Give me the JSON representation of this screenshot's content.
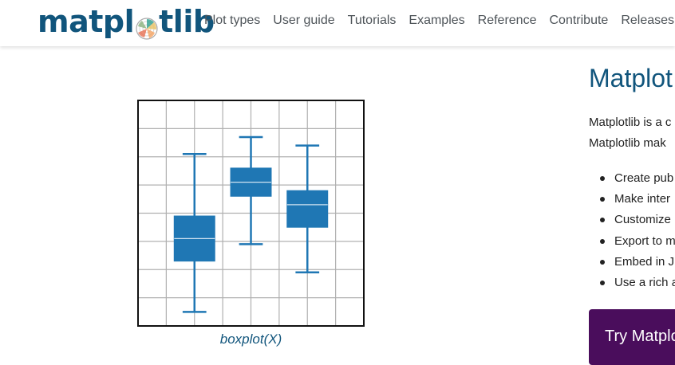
{
  "header": {
    "logo_text_left": "matpl",
    "logo_text_right": "tlib",
    "nav": [
      "Plot types",
      "User guide",
      "Tutorials",
      "Examples",
      "Reference",
      "Contribute",
      "Releases"
    ]
  },
  "figure": {
    "caption": "boxplot(X)"
  },
  "chart_data": {
    "type": "boxplot",
    "title": "",
    "xlabel": "",
    "ylabel": "",
    "xlim": [
      0,
      8
    ],
    "ylim": [
      0,
      8
    ],
    "grid": true,
    "color": "#1f77b4",
    "boxes": [
      {
        "x": 2,
        "whisker_low": 0.5,
        "q1": 2.3,
        "median": 3.1,
        "q3": 3.9,
        "whisker_high": 6.1
      },
      {
        "x": 4,
        "whisker_low": 2.9,
        "q1": 4.6,
        "median": 5.1,
        "q3": 5.6,
        "whisker_high": 6.7
      },
      {
        "x": 6,
        "whisker_low": 1.9,
        "q1": 3.5,
        "median": 4.3,
        "q3": 4.8,
        "whisker_high": 6.4
      }
    ]
  },
  "content": {
    "title": "Matplot",
    "intro_line1": "Matplotlib is a c",
    "intro_line2": "Matplotlib mak",
    "bullets": [
      "Create pub",
      "Make inter",
      "Customize",
      "Export to m",
      "Embed in J",
      "Use a rich a"
    ],
    "try_button": "Try Matplo"
  },
  "colors": {
    "brand": "#11557c",
    "nav_text": "#4e5459",
    "button_bg": "#4a0d5c"
  }
}
